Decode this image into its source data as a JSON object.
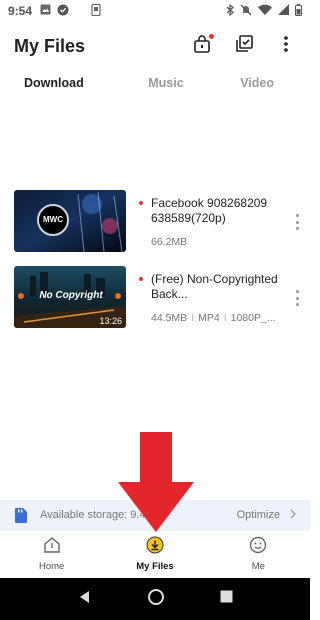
{
  "status_bar": {
    "time": "9:54"
  },
  "header": {
    "title": "My Files"
  },
  "tabs": [
    {
      "label": "Download",
      "active": true
    },
    {
      "label": "Music",
      "active": false
    },
    {
      "label": "Video",
      "active": false
    }
  ],
  "files": [
    {
      "name": "Facebook 908268209 638589(720p)",
      "meta": "66.2MB",
      "thumb_text": "MWC"
    },
    {
      "name": "(Free) Non-Copyrighted Back...",
      "size": "44.5MB",
      "format": "MP4",
      "resolution": "1080P_...",
      "duration": "13:26",
      "thumb_text": "No Copyright"
    }
  ],
  "storage": {
    "label": "Available storage: 9.4",
    "action": "Optimize"
  },
  "bottom_nav": [
    {
      "label": "Home",
      "active": false
    },
    {
      "label": "My Files",
      "active": true
    },
    {
      "label": "Me",
      "active": false
    }
  ],
  "colors": {
    "accent_red": "#e53935",
    "annotation_red": "#e3262b",
    "download_icon_yellow": "#f5c518"
  }
}
